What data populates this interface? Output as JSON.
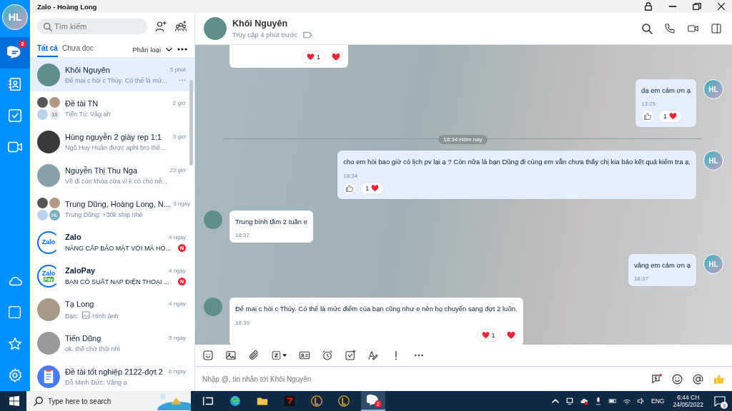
{
  "window": {
    "title": "Zalo - Hoàng Long"
  },
  "sidebar": {
    "initials": "HL",
    "items": [
      {
        "kind": "chat",
        "selected": true,
        "badge": "2"
      },
      {
        "kind": "contacts",
        "selected": false
      },
      {
        "kind": "todo",
        "selected": false
      },
      {
        "kind": "video",
        "selected": false
      }
    ],
    "bottom_items": [
      {
        "kind": "cloud"
      },
      {
        "kind": "capture"
      },
      {
        "kind": "star"
      },
      {
        "kind": "settings"
      }
    ]
  },
  "search": {
    "placeholder": "Tìm kiếm"
  },
  "tabs": [
    {
      "label": "Tất cả",
      "selected": true
    },
    {
      "label": "Chưa đọc",
      "selected": false
    }
  ],
  "filter": {
    "label": "Phân loại"
  },
  "conversations": [
    {
      "name": "Khôi Nguyên",
      "time": "5 phút",
      "preview": "Để mai c hỏi c Thúy. Có thể là mứ...",
      "selected": true,
      "unread": false,
      "avatar": {
        "kind": "photo",
        "color": "#5f8f8a"
      }
    },
    {
      "name": "Đề tài TN",
      "time": "2 giờ",
      "preview": "Tiến Tú: Vâg ah",
      "selected": false,
      "unread": false,
      "avatar": {
        "kind": "group",
        "count": "10"
      }
    },
    {
      "name": "Hùng nguyễn 2 giày rep 1:1",
      "time": "3 giờ",
      "preview": "Ngô Huy Huân được aphi bro thê...",
      "selected": false,
      "unread": false,
      "avatar": {
        "kind": "photo",
        "color": "#3a3a3a"
      }
    },
    {
      "name": "Nguyễn Thị Thu Nga",
      "time": "23 giờ",
      "preview": "Về đi còn khóa cửa vì k có chó nê...",
      "selected": false,
      "unread": false,
      "avatar": {
        "kind": "photo",
        "color": "#8aa0a8"
      }
    },
    {
      "name": "Trung Dũng, Hoàng Long, N...",
      "time": "3 ngày",
      "preview": "Trung Dũng: +30k ship nhé",
      "selected": false,
      "unread": false,
      "avatar": {
        "kind": "group",
        "initials": "HL"
      }
    },
    {
      "name": "Zalo",
      "time": "4 ngày",
      "preview": "NÂNG CẤP BẢO MẬT VỚI MÃ HÓ...",
      "selected": false,
      "unread": true,
      "unread_marker": "N",
      "avatar": {
        "kind": "logo",
        "text": "Zalo"
      }
    },
    {
      "name": "ZaloPay",
      "time": "4 ngày",
      "preview": "BẠN CÓ SUẤT NẠP ĐIỆN THOẠI ...",
      "selected": false,
      "unread": true,
      "unread_marker": "N",
      "avatar": {
        "kind": "logo",
        "text": "Zalo",
        "sub": "Pay"
      }
    },
    {
      "name": "Tạ Long",
      "time": "4 ngày",
      "preview": "Bạn: ",
      "attachment": "Hình ảnh",
      "selected": false,
      "unread": false,
      "avatar": {
        "kind": "photo",
        "color": "#a89a88"
      }
    },
    {
      "name": "Tiến Dũng",
      "time": "5 ngày",
      "preview": "ok. thế chờ thôi nhỉ",
      "selected": false,
      "unread": false,
      "avatar": {
        "kind": "photo",
        "color": "#9a9a9a"
      }
    },
    {
      "name": "Đề tài tốt nghiệp 2122-đợt 2",
      "time": "6 ngày",
      "preview": "Đỗ Minh Đức: Vâng ạ",
      "selected": false,
      "unread": false,
      "avatar": {
        "kind": "doc"
      }
    }
  ],
  "chat": {
    "name": "Khôi Nguyên",
    "status": "Truy cập 4 phút trước",
    "messages": [
      {
        "kind": "incoming",
        "partial": true,
        "reactions": [
          {
            "kind": "summary",
            "count": "1"
          },
          {
            "kind": "heart-button"
          }
        ]
      },
      {
        "kind": "outgoing",
        "text": "dạ em cảm ơn ạ",
        "time": "13:25",
        "avatar_initials": "HL",
        "reactions": [
          {
            "kind": "like-button"
          },
          {
            "kind": "summary",
            "count": "1"
          }
        ]
      },
      {
        "kind": "divider",
        "text": "18:34 Hôm nay"
      },
      {
        "kind": "outgoing",
        "text": "cho em hỏi bao giờ có lịch pv lại ạ ? Còn nữa là bạn Dũng đi cùng em vẫn chưa thấy chị kia báo kết quả kiểm tra ạ.",
        "time": "18:34",
        "avatar_initials": "HL",
        "reactions": [
          {
            "kind": "like-button"
          },
          {
            "kind": "summary",
            "count": "1"
          }
        ]
      },
      {
        "kind": "incoming",
        "text": "Trung bình tầm 2 tuần e",
        "time": "18:37"
      },
      {
        "kind": "outgoing",
        "text": "vâng em cám ơn ạ",
        "time": "18:37",
        "avatar_initials": "HL"
      },
      {
        "kind": "incoming",
        "text": "Để mai c hỏi c Thúy. Có thể là mức điểm của bạn cũng như e nên họ chuyển sang đợt 2 luôn.",
        "time": "18:39",
        "reactions": [
          {
            "kind": "summary",
            "count": "1"
          },
          {
            "kind": "heart-button"
          }
        ]
      }
    ],
    "composer": {
      "placeholder": "Nhập @, tin nhắn tới Khôi Nguyên"
    }
  },
  "taskbar": {
    "search_placeholder": "Type here to search",
    "app_badge": "2",
    "language": "ENG",
    "time": "6:44 CH",
    "date": "24/05/2022",
    "notifications": "3"
  }
}
